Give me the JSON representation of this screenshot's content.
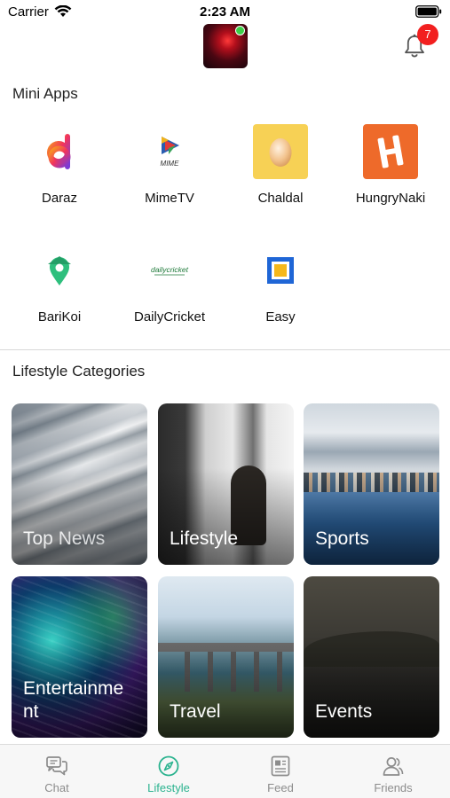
{
  "status_bar": {
    "carrier": "Carrier",
    "time": "2:23 AM"
  },
  "header": {
    "notification_count": "7"
  },
  "mini_apps": {
    "title": "Mini Apps",
    "items": [
      {
        "label": "Daraz",
        "icon": "daraz-logo"
      },
      {
        "label": "MimeTV",
        "icon": "mimetv-logo"
      },
      {
        "label": "Chaldal",
        "icon": "chaldal-egg-logo"
      },
      {
        "label": "HungryNaki",
        "icon": "hungrynaki-logo"
      },
      {
        "label": "BariKoi",
        "icon": "barikoi-pin-logo"
      },
      {
        "label": "DailyCricket",
        "icon": "dailycricket-logo"
      },
      {
        "label": "Easy",
        "icon": "easy-square-logo"
      }
    ],
    "logo_texts": {
      "mimetv": "MIME",
      "dailycricket": "dailycricket",
      "hungrynaki": "H"
    }
  },
  "lifestyle": {
    "title": "Lifestyle Categories",
    "cards": [
      {
        "label": "Top News"
      },
      {
        "label": "Lifestyle"
      },
      {
        "label": "Sports"
      },
      {
        "label": "Entertainme nt"
      },
      {
        "label": "Travel"
      },
      {
        "label": "Events"
      }
    ]
  },
  "tabs": [
    {
      "label": "Chat",
      "icon": "chat-icon",
      "active": false
    },
    {
      "label": "Lifestyle",
      "icon": "compass-icon",
      "active": true
    },
    {
      "label": "Feed",
      "icon": "feed-icon",
      "active": false
    },
    {
      "label": "Friends",
      "icon": "friends-icon",
      "active": false
    }
  ],
  "colors": {
    "accent": "#2bb38f",
    "badge": "#f21f1f",
    "online": "#3ccf48",
    "inactive_tab": "#8c8c8c"
  }
}
